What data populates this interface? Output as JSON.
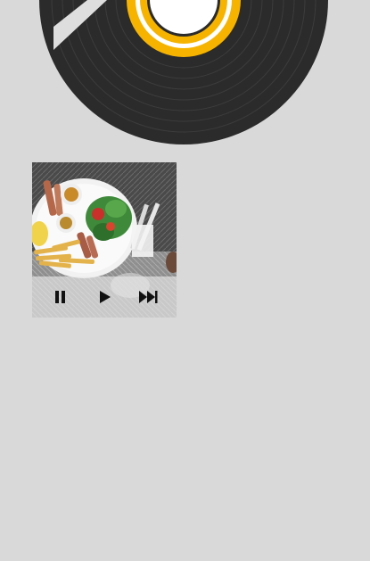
{
  "player": {
    "controls": [
      {
        "name": "pause-icon",
        "action": "pause"
      },
      {
        "name": "play-icon",
        "action": "play"
      },
      {
        "name": "fast-forward-icon",
        "action": "next"
      }
    ]
  },
  "colors": {
    "background": "#d9d9d9",
    "vinyl": "#2b2b2b",
    "label_accent": "#f6b400",
    "label_center": "#2b2b2b"
  }
}
